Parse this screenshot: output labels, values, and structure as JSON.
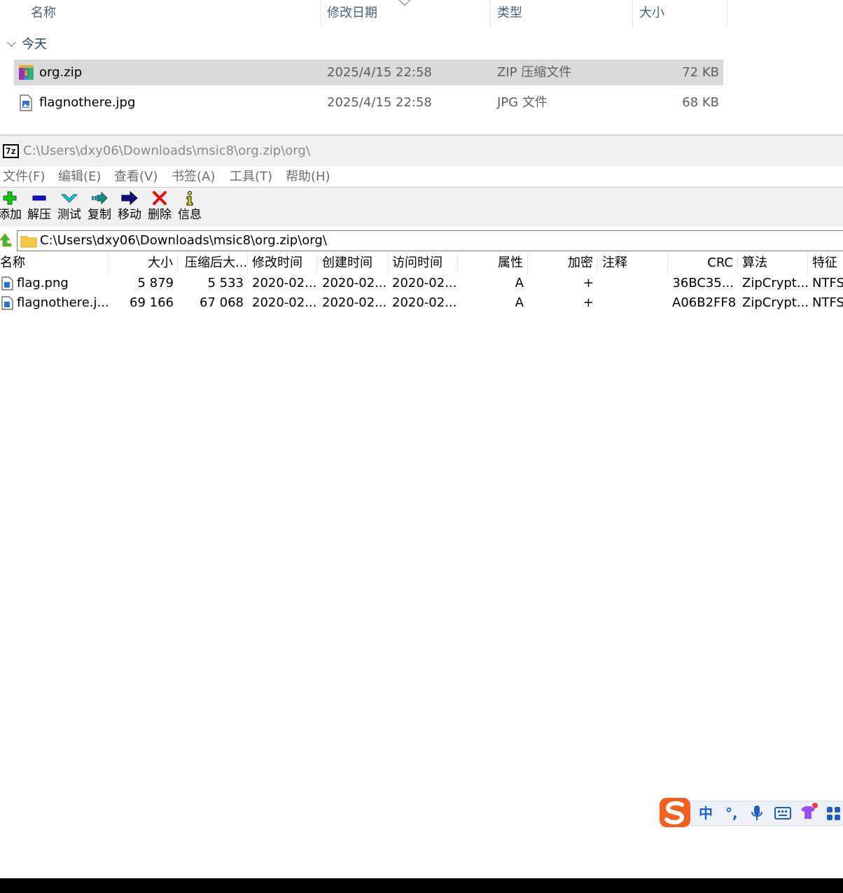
{
  "explorer": {
    "columns": {
      "name": "名称",
      "modified": "修改日期",
      "type": "类型",
      "size": "大小"
    },
    "group_label": "今天",
    "files": [
      {
        "name": "org.zip",
        "modified": "2025/4/15 22:58",
        "type": "ZIP 压缩文件",
        "size": "72 KB",
        "icon": "zip-archive-icon",
        "selected": true
      },
      {
        "name": "flagnothere.jpg",
        "modified": "2025/4/15 22:58",
        "type": "JPG 文件",
        "size": "68 KB",
        "icon": "image-file-icon",
        "selected": false
      }
    ]
  },
  "sevenzip": {
    "logo_text": "7z",
    "title": "C:\\Users\\dxy06\\Downloads\\msic8\\org.zip\\org\\",
    "menu": [
      "文件(F)",
      "编辑(E)",
      "查看(V)",
      "书签(A)",
      "工具(T)",
      "帮助(H)"
    ],
    "toolbar": [
      {
        "label": "添加",
        "icon": "add-icon",
        "color": "#19c219"
      },
      {
        "label": "解压",
        "icon": "extract-icon",
        "color": "#1010d8"
      },
      {
        "label": "测试",
        "icon": "test-icon",
        "color": "#22c8d8"
      },
      {
        "label": "复制",
        "icon": "copy-icon",
        "color": "#1a8a8a"
      },
      {
        "label": "移动",
        "icon": "move-icon",
        "color": "#10107a"
      },
      {
        "label": "删除",
        "icon": "delete-icon",
        "color": "#e01010"
      },
      {
        "label": "信息",
        "icon": "info-icon",
        "color": "#e0e010"
      }
    ],
    "address_path": "C:\\Users\\dxy06\\Downloads\\msic8\\org.zip\\org\\",
    "columns": [
      "名称",
      "大小",
      "压缩后大...",
      "修改时间",
      "创建时间",
      "访问时间",
      "属性",
      "加密",
      "注释",
      "CRC",
      "算法",
      "特征"
    ],
    "rows": [
      {
        "name": "flag.png",
        "size": "5 879",
        "packed": "5 533",
        "modified": "2020-02...",
        "created": "2020-02...",
        "accessed": "2020-02...",
        "attr": "A",
        "encrypted": "+",
        "comment": "",
        "crc": "36BC35...",
        "method": "ZipCrypt...",
        "characteristics": "NTFS"
      },
      {
        "name": "flagnothere.j...",
        "size": "69 166",
        "packed": "67 068",
        "modified": "2020-02...",
        "created": "2020-02...",
        "accessed": "2020-02...",
        "attr": "A",
        "encrypted": "+",
        "comment": "",
        "crc": "A06B2FF8",
        "method": "ZipCrypt...",
        "characteristics": "NTFS"
      }
    ]
  },
  "ime": {
    "mode": "中",
    "punct": "°,",
    "logo_color": "#f0601e",
    "icons": [
      "sogou-logo-icon",
      "microphone-icon",
      "keyboard-icon",
      "skin-icon",
      "toolbox-icon"
    ]
  }
}
